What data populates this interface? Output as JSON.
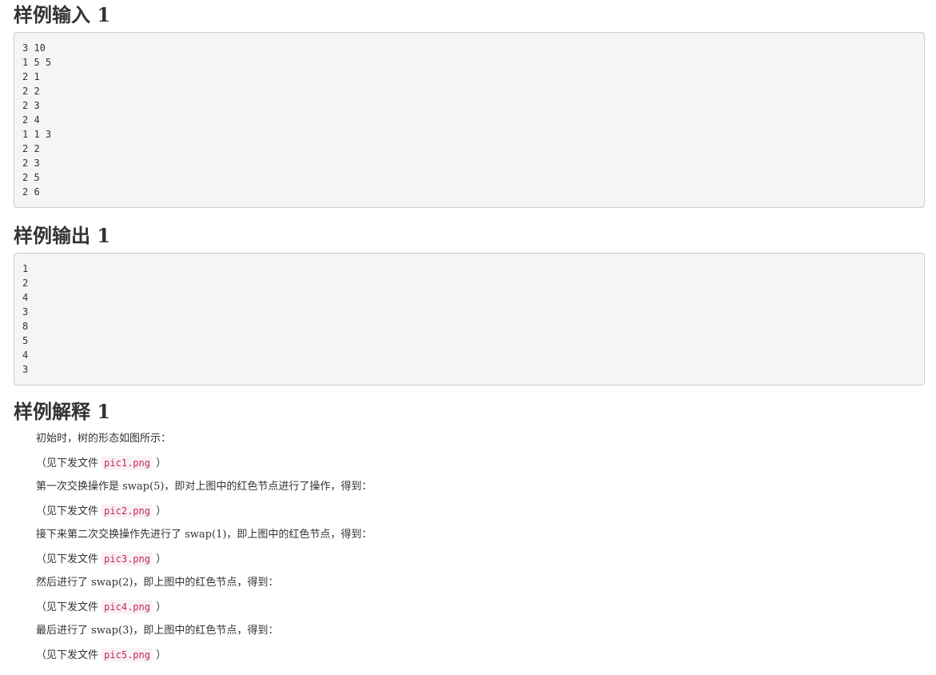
{
  "sections": {
    "input": {
      "title": "样例输入 1",
      "lines": [
        "3 10",
        "1 5 5",
        "2 1",
        "2 2",
        "2 3",
        "2 4",
        "1 1 3",
        "2 2",
        "2 3",
        "2 5",
        "2 6"
      ]
    },
    "output": {
      "title": "样例输出 1",
      "lines": [
        "1",
        "2",
        "4",
        "3",
        "8",
        "5",
        "4",
        "3"
      ]
    },
    "explanation": {
      "title": "样例解释 1",
      "lines": [
        {
          "text": "初始时，树的形态如图所示："
        },
        {
          "pre": "（见下发文件 ",
          "code": "pic1.png",
          "post": " ）"
        },
        {
          "text": "第一次交换操作是 swap(5)，即对上图中的红色节点进行了操作，得到："
        },
        {
          "pre": "（见下发文件 ",
          "code": "pic2.png",
          "post": " ）"
        },
        {
          "text": "接下来第二次交换操作先进行了 swap(1)，即上图中的红色节点，得到："
        },
        {
          "pre": "（见下发文件 ",
          "code": "pic3.png",
          "post": " ）"
        },
        {
          "text": "然后进行了 swap(2)，即上图中的红色节点，得到："
        },
        {
          "pre": "（见下发文件 ",
          "code": "pic4.png",
          "post": " ）"
        },
        {
          "text": "最后进行了 swap(3)，即上图中的红色节点，得到："
        },
        {
          "pre": "（见下发文件 ",
          "code": "pic5.png",
          "post": " ）"
        }
      ]
    }
  }
}
